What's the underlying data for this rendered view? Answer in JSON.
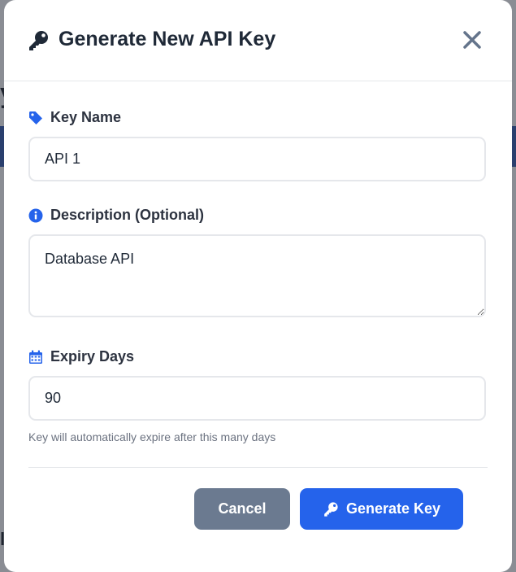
{
  "modal": {
    "title": "Generate New API Key",
    "title_icon": "key-icon",
    "close_icon": "close-icon"
  },
  "form": {
    "key_name": {
      "label": "Key Name",
      "icon": "tag-icon",
      "value": "API 1"
    },
    "description": {
      "label": "Description (Optional)",
      "icon": "info-circle-icon",
      "value": "Database API"
    },
    "expiry_days": {
      "label": "Expiry Days",
      "icon": "calendar-icon",
      "value": "90",
      "hint": "Key will automatically expire after this many days"
    }
  },
  "actions": {
    "cancel_label": "Cancel",
    "generate_label": "Generate Key",
    "generate_icon": "key-icon"
  },
  "colors": {
    "primary": "#2563eb",
    "secondary": "#6b7a90",
    "title_text": "#1f2937",
    "icon_blue": "#2563eb"
  }
}
